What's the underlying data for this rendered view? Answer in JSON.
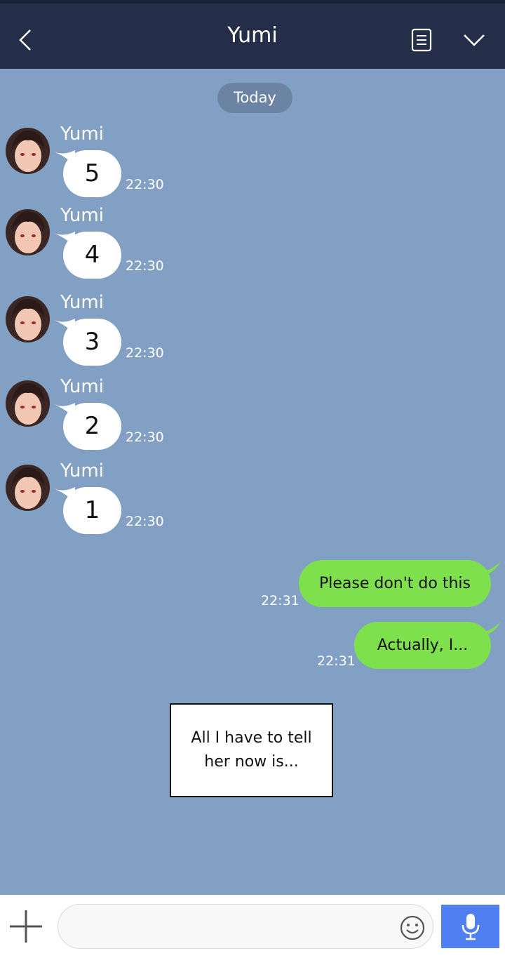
{
  "header": {
    "title": "Yumi",
    "back_icon": "chevron-left-icon",
    "notes_icon": "notes-icon",
    "expand_icon": "chevron-down-icon"
  },
  "chat": {
    "date_label": "Today",
    "incoming": [
      {
        "sender": "Yumi",
        "text": "5",
        "time": "22:30"
      },
      {
        "sender": "Yumi",
        "text": "4",
        "time": "22:30"
      },
      {
        "sender": "Yumi",
        "text": "3",
        "time": "22:30"
      },
      {
        "sender": "Yumi",
        "text": "2",
        "time": "22:30"
      },
      {
        "sender": "Yumi",
        "text": "1",
        "time": "22:30"
      }
    ],
    "outgoing": [
      {
        "text": "Please don't do this",
        "time": "22:31"
      },
      {
        "text": "Actually, I...",
        "time": "22:31"
      }
    ],
    "caption": "All I have to tell her now is..."
  },
  "input_bar": {
    "placeholder": "",
    "value": "",
    "plus_icon": "plus-icon",
    "emoji_icon": "smiley-icon",
    "mic_icon": "microphone-icon"
  },
  "colors": {
    "header_bg": "#252e48",
    "chat_bg": "#82a0c3",
    "outgoing_bubble": "#7fe04e",
    "incoming_bubble": "#ffffff",
    "mic_button": "#4f7ff0"
  }
}
